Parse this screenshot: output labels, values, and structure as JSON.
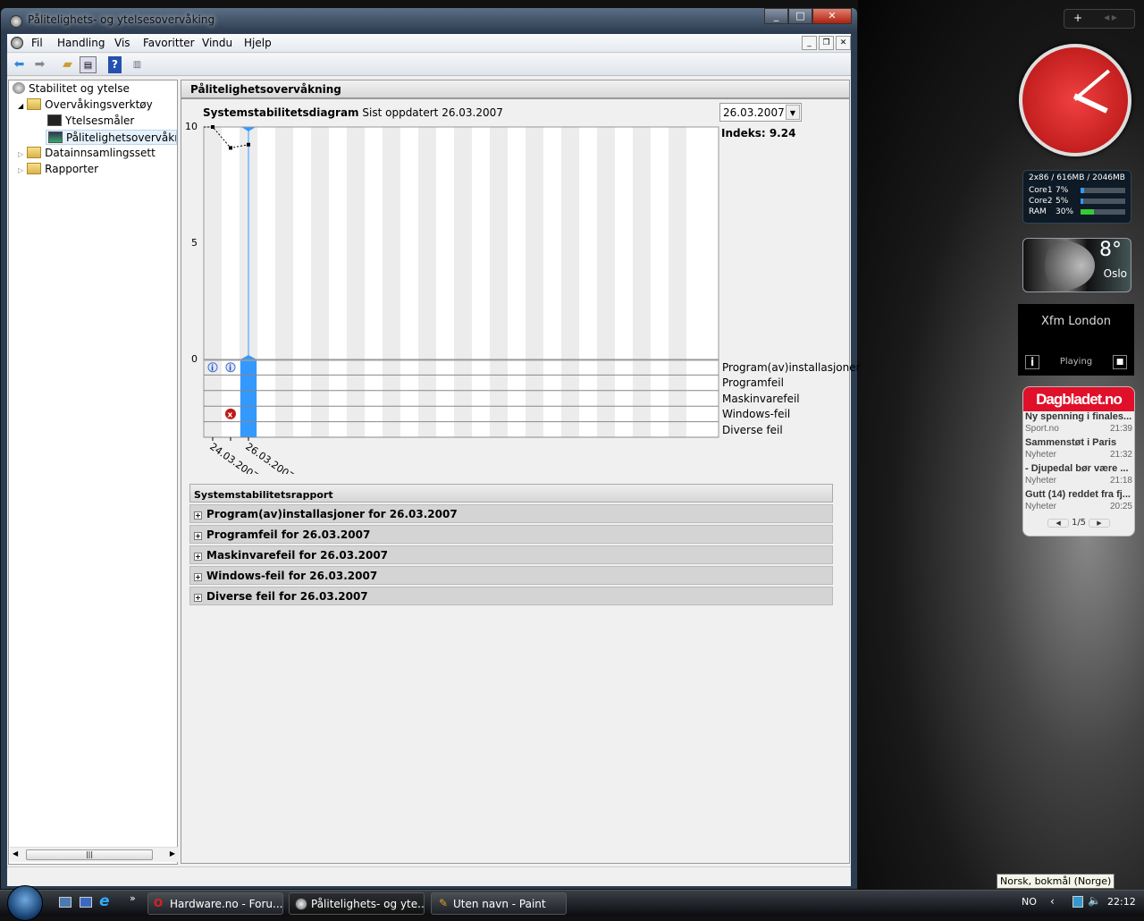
{
  "window": {
    "title": "Pålitelighets- og ytelsesovervåking",
    "controls": [
      "_",
      "□",
      "✕"
    ]
  },
  "menu": [
    "Fil",
    "Handling",
    "Vis",
    "Favoritter",
    "Vindu",
    "Hjelp"
  ],
  "mdi_controls": [
    "_",
    "❐",
    "✕"
  ],
  "tree": [
    {
      "label": "Stabilitet og ytelse",
      "icon": "perf-icon"
    },
    {
      "label": "Overvåkingsverktøy",
      "icon": "folder-icon",
      "expanded": true
    },
    {
      "label": "Ytelsesmåler",
      "icon": "monitor-icon"
    },
    {
      "label": "Pålitelighetsovervåknin",
      "icon": "monitor-icon",
      "selected": true
    },
    {
      "label": "Datainnsamlingssett",
      "icon": "folder-icon"
    },
    {
      "label": "Rapporter",
      "icon": "folder-icon"
    }
  ],
  "panel": {
    "title": "Pålitelighetsovervåkning"
  },
  "date_select": {
    "value": "26.03.2007"
  },
  "index_label": "Indeks: 9.24",
  "chart_data": {
    "type": "line",
    "title": "Systemstabilitetsdiagram",
    "subtitle": "Sist oppdatert 26.03.2007",
    "ylim": [
      0,
      10
    ],
    "yticks": [
      "10",
      "5",
      "0"
    ],
    "x_labels": [
      "24.03.2007",
      "26.03.2007"
    ],
    "x": [
      "24.03.2007",
      "25.03.2007",
      "26.03.2007"
    ],
    "values": [
      10,
      9.1,
      9.24
    ],
    "selected": "26.03.2007",
    "accent": "#3399ff",
    "event_rows": [
      "Program(av)installasjoner",
      "Programfeil",
      "Maskinvarefeil",
      "Windows-feil",
      "Diverse feil"
    ],
    "events": [
      {
        "row": "Program(av)installasjoner",
        "date": "24.03.2007",
        "icon": "info-icon"
      },
      {
        "row": "Program(av)installasjoner",
        "date": "25.03.2007",
        "icon": "info-icon"
      },
      {
        "row": "Windows-feil",
        "date": "25.03.2007",
        "icon": "error-icon"
      }
    ]
  },
  "report": {
    "title": "Systemstabilitetsrapport",
    "rows": [
      "Program(av)installasjoner for 26.03.2007",
      "Programfeil for 26.03.2007",
      "Maskinvarefeil for 26.03.2007",
      "Windows-feil for 26.03.2007",
      "Diverse feil for 26.03.2007"
    ]
  },
  "gadgets": {
    "meter": {
      "header": "2x86 / 616MB / 2046MB",
      "rows": [
        {
          "label": "Core1",
          "value": "7%",
          "pct": 7
        },
        {
          "label": "Core2",
          "value": "5%",
          "pct": 5
        },
        {
          "label": "RAM",
          "value": "30%",
          "pct": 30
        }
      ]
    },
    "weather": {
      "temp": "8°",
      "city": "Oslo"
    },
    "radio": {
      "station": "Xfm London",
      "status": "Playing"
    },
    "news": {
      "brand": "Dagbladet.no",
      "items": [
        {
          "title": "Ny spenning i finales...",
          "section": "Sport.no",
          "time": "21:39"
        },
        {
          "title": "Sammenstøt i Paris",
          "section": "Nyheter",
          "time": "21:32"
        },
        {
          "title": "- Djupedal bør være ...",
          "section": "Nyheter",
          "time": "21:18"
        },
        {
          "title": "Gutt (14) reddet fra fj...",
          "section": "Nyheter",
          "time": "20:25"
        }
      ],
      "page": "1/5"
    }
  },
  "language_tooltip": "Norsk, bokmål (Norge)",
  "taskbar": {
    "items": [
      "Hardware.no - Foru...",
      "Pålitelighets- og yte...",
      "Uten navn - Paint"
    ],
    "lang": "NO",
    "clock": "22:12"
  }
}
